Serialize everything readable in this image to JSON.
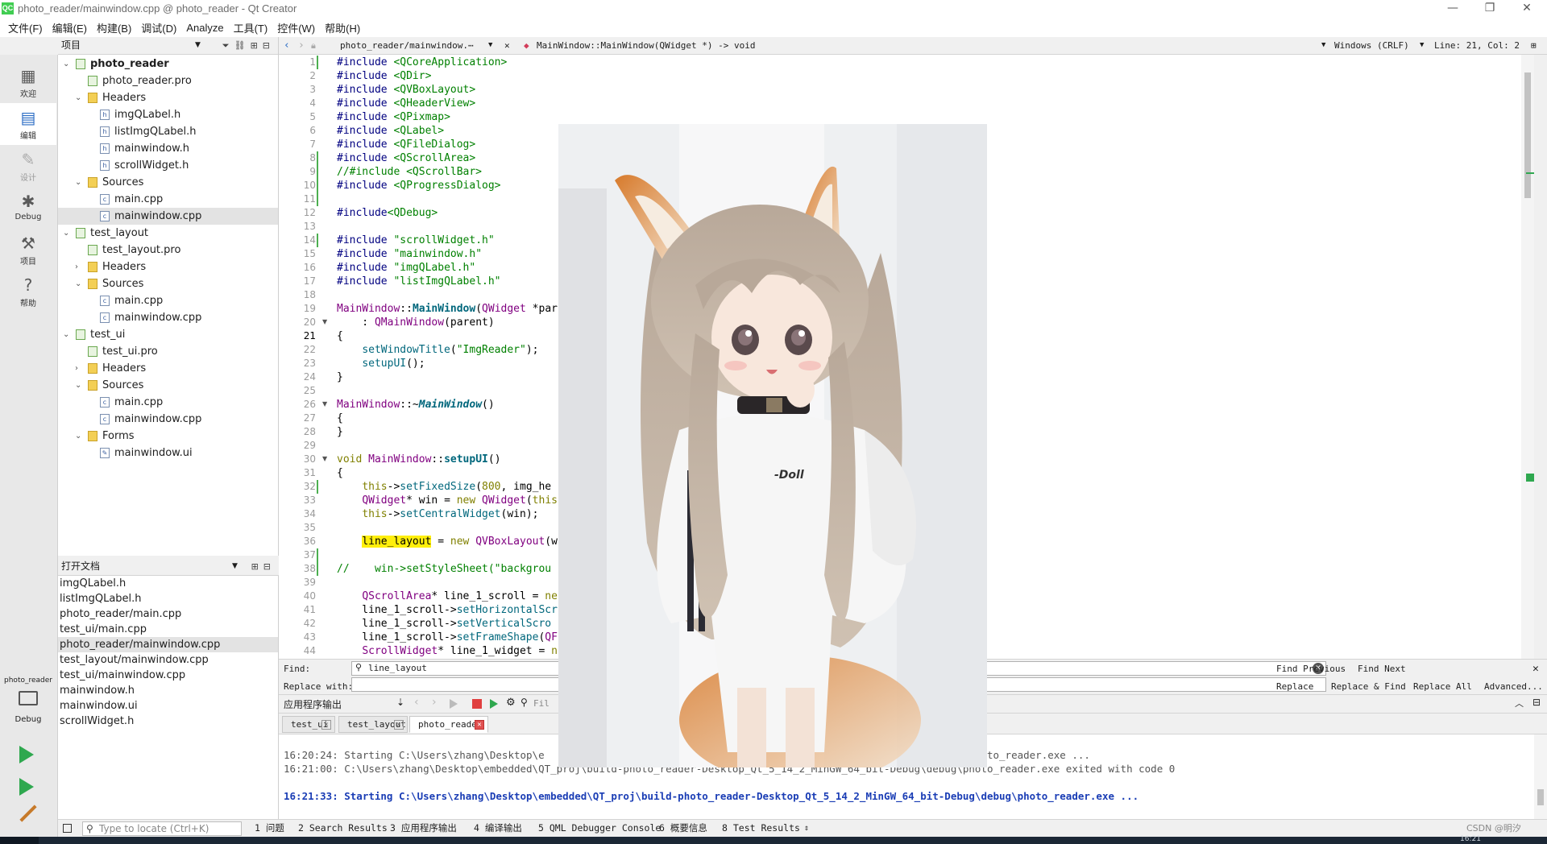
{
  "window": {
    "title": "photo_reader/mainwindow.cpp @ photo_reader - Qt Creator",
    "logo": "QC"
  },
  "menu": [
    "文件(F)",
    "编辑(E)",
    "构建(B)",
    "调试(D)",
    "Analyze",
    "工具(T)",
    "控件(W)",
    "帮助(H)"
  ],
  "modes": [
    {
      "label": "欢迎",
      "icon": "grid-icon"
    },
    {
      "label": "编辑",
      "icon": "edit-doc-icon"
    },
    {
      "label": "设计",
      "icon": "pencil-icon"
    },
    {
      "label": "Debug",
      "icon": "bug-icon"
    },
    {
      "label": "项目",
      "icon": "wrench-icon"
    },
    {
      "label": "帮助",
      "icon": "help-icon"
    }
  ],
  "kit": {
    "project": "photo_reader",
    "config": "Debug"
  },
  "project_panel": {
    "title": "项目",
    "tree": [
      {
        "text": "photo_reader",
        "depth": 0,
        "type": "pro-root",
        "expanded": true,
        "bold": true
      },
      {
        "text": "photo_reader.pro",
        "depth": 1,
        "type": "pro"
      },
      {
        "text": "Headers",
        "depth": 1,
        "type": "folder",
        "expanded": true
      },
      {
        "text": "imgQLabel.h",
        "depth": 2,
        "type": "file"
      },
      {
        "text": "listImgQLabel.h",
        "depth": 2,
        "type": "file"
      },
      {
        "text": "mainwindow.h",
        "depth": 2,
        "type": "file"
      },
      {
        "text": "scrollWidget.h",
        "depth": 2,
        "type": "file"
      },
      {
        "text": "Sources",
        "depth": 1,
        "type": "folder",
        "expanded": true
      },
      {
        "text": "main.cpp",
        "depth": 2,
        "type": "file"
      },
      {
        "text": "mainwindow.cpp",
        "depth": 2,
        "type": "file",
        "selected": true
      },
      {
        "text": "test_layout",
        "depth": 0,
        "type": "pro-root",
        "expanded": true
      },
      {
        "text": "test_layout.pro",
        "depth": 1,
        "type": "pro"
      },
      {
        "text": "Headers",
        "depth": 1,
        "type": "folder",
        "expanded": false
      },
      {
        "text": "Sources",
        "depth": 1,
        "type": "folder",
        "expanded": true
      },
      {
        "text": "main.cpp",
        "depth": 2,
        "type": "file"
      },
      {
        "text": "mainwindow.cpp",
        "depth": 2,
        "type": "file"
      },
      {
        "text": "test_ui",
        "depth": 0,
        "type": "pro-root",
        "expanded": true
      },
      {
        "text": "test_ui.pro",
        "depth": 1,
        "type": "pro"
      },
      {
        "text": "Headers",
        "depth": 1,
        "type": "folder",
        "expanded": false
      },
      {
        "text": "Sources",
        "depth": 1,
        "type": "folder",
        "expanded": true
      },
      {
        "text": "main.cpp",
        "depth": 2,
        "type": "file"
      },
      {
        "text": "mainwindow.cpp",
        "depth": 2,
        "type": "file"
      },
      {
        "text": "Forms",
        "depth": 1,
        "type": "folder",
        "expanded": true
      },
      {
        "text": "mainwindow.ui",
        "depth": 2,
        "type": "ui"
      }
    ]
  },
  "open_docs": {
    "title": "打开文档",
    "items": [
      {
        "text": "imgQLabel.h"
      },
      {
        "text": "listImgQLabel.h"
      },
      {
        "text": "photo_reader/main.cpp"
      },
      {
        "text": "test_ui/main.cpp"
      },
      {
        "text": "photo_reader/mainwindow.cpp",
        "selected": true
      },
      {
        "text": "test_layout/mainwindow.cpp"
      },
      {
        "text": "test_ui/mainwindow.cpp"
      },
      {
        "text": "mainwindow.h"
      },
      {
        "text": "mainwindow.ui"
      },
      {
        "text": "scrollWidget.h"
      }
    ]
  },
  "editor_toolbar": {
    "file": "photo_reader/mainwindow.⋯",
    "symbol": "MainWindow::MainWindow(QWidget *) -> void",
    "encoding": "Windows (CRLF)",
    "position": "Line: 21, Col: 2"
  },
  "editor": {
    "current_line": 21,
    "lines": [
      {
        "n": 1,
        "chg": true,
        "html": "<span class=\"pp\">#include</span> <span class=\"str\">&lt;QCoreApplication&gt;</span>"
      },
      {
        "n": 2,
        "html": "<span class=\"pp\">#include</span> <span class=\"str\">&lt;QDir&gt;</span>"
      },
      {
        "n": 3,
        "html": "<span class=\"pp\">#include</span> <span class=\"str\">&lt;QVBoxLayout&gt;</span>"
      },
      {
        "n": 4,
        "html": "<span class=\"pp\">#include</span> <span class=\"str\">&lt;QHeaderView&gt;</span>"
      },
      {
        "n": 5,
        "html": "<span class=\"pp\">#include</span> <span class=\"str\">&lt;QPixmap&gt;</span>"
      },
      {
        "n": 6,
        "html": "<span class=\"pp\">#include</span> <span class=\"str\">&lt;QLabel&gt;</span>"
      },
      {
        "n": 7,
        "html": "<span class=\"pp\">#include</span> <span class=\"str\">&lt;QFileDialog&gt;</span>"
      },
      {
        "n": 8,
        "chg": true,
        "html": "<span class=\"pp\">#include</span> <span class=\"str\">&lt;QScrollArea&gt;</span>"
      },
      {
        "n": 9,
        "chg": true,
        "html": "<span class=\"cm\">//#include &lt;QScrollBar&gt;</span>"
      },
      {
        "n": 10,
        "chg": true,
        "html": "<span class=\"pp\">#include</span> <span class=\"str\">&lt;QProgressDialog&gt;</span>"
      },
      {
        "n": 11,
        "chg": true,
        "html": ""
      },
      {
        "n": 12,
        "html": "<span class=\"pp\">#include</span><span class=\"str\">&lt;QDebug&gt;</span>"
      },
      {
        "n": 13,
        "html": ""
      },
      {
        "n": 14,
        "chg": true,
        "html": "<span class=\"pp\">#include</span> <span class=\"str\">\"scrollWidget.h\"</span>"
      },
      {
        "n": 15,
        "html": "<span class=\"pp\">#include</span> <span class=\"str\">\"mainwindow.h\"</span>"
      },
      {
        "n": 16,
        "html": "<span class=\"pp\">#include</span> <span class=\"str\">\"imgQLabel.h\"</span>"
      },
      {
        "n": 17,
        "html": "<span class=\"pp\">#include</span> <span class=\"str\">\"listImgQLabel.h\"</span>"
      },
      {
        "n": 18,
        "html": ""
      },
      {
        "n": 19,
        "html": "<span class=\"cls\">MainWindow</span>::<span class=\"fn\"><b>MainWindow</b></span>(<span class=\"cls\">QWidget</span> *par"
      },
      {
        "n": 20,
        "fold": true,
        "html": "    : <span class=\"cls\">QMainWindow</span>(parent)"
      },
      {
        "n": 21,
        "html": "{"
      },
      {
        "n": 22,
        "html": "    <span class=\"fn\">setWindowTitle</span>(<span class=\"str\">\"ImgReader\"</span>);"
      },
      {
        "n": 23,
        "html": "    <span class=\"fn\">setupUI</span>();"
      },
      {
        "n": 24,
        "html": "}"
      },
      {
        "n": 25,
        "html": ""
      },
      {
        "n": 26,
        "fold": true,
        "html": "<span class=\"cls\">MainWindow</span>::~<span class=\"fni\"><b>MainWindow</b></span>()"
      },
      {
        "n": 27,
        "html": "{"
      },
      {
        "n": 28,
        "html": "}"
      },
      {
        "n": 29,
        "html": ""
      },
      {
        "n": 30,
        "fold": true,
        "html": "<span class=\"kw\">void</span> <span class=\"cls\">MainWindow</span>::<span class=\"fn\"><b>setupUI</b></span>()"
      },
      {
        "n": 31,
        "html": "{"
      },
      {
        "n": 32,
        "chg": true,
        "html": "    <span class=\"kw\">this</span>-&gt;<span class=\"fn\">setFixedSize</span>(<span class=\"kw\">800</span>, img_he"
      },
      {
        "n": 33,
        "html": "    <span class=\"cls\">QWidget</span>* win = <span class=\"kw\">new</span> <span class=\"cls\">QWidget</span>(<span class=\"kw\">this</span>"
      },
      {
        "n": 34,
        "html": "    <span class=\"kw\">this</span>-&gt;<span class=\"fn\">setCentralWidget</span>(win);"
      },
      {
        "n": 35,
        "html": ""
      },
      {
        "n": 36,
        "html": "    <span class=\"hl\">line_layout</span> = <span class=\"kw\">new</span> <span class=\"cls\">QVBoxLayout</span>(w"
      },
      {
        "n": 37,
        "chg": true,
        "html": ""
      },
      {
        "n": 38,
        "chg": true,
        "html": "<span class=\"cm\">//    win-&gt;setStyleSheet(\"backgrou</span>"
      },
      {
        "n": 39,
        "html": ""
      },
      {
        "n": 40,
        "html": "    <span class=\"cls\">QScrollArea</span>* line_1_scroll = <span class=\"kw\">ne</span>"
      },
      {
        "n": 41,
        "html": "    line_1_scroll-&gt;<span class=\"fn\">setHorizontalScr</span>"
      },
      {
        "n": 42,
        "html": "    line_1_scroll-&gt;<span class=\"fn\">setVerticalScro</span>"
      },
      {
        "n": 43,
        "html": "    line_1_scroll-&gt;<span class=\"fn\">setFrameShape</span>(<span class=\"cls\">QF</span>"
      },
      {
        "n": 44,
        "html": "    <span class=\"cls\">ScrollWidget</span>* line_1_widget = <span class=\"kw\">n</span>"
      }
    ]
  },
  "find": {
    "find_label": "Find:",
    "replace_label": "Replace with:",
    "find_value": "line_layout",
    "find_previous": "Find Previous",
    "find_next": "Find Next",
    "replace": "Replace",
    "replace_find": "Replace & Find",
    "replace_all": "Replace All",
    "advanced": "Advanced..."
  },
  "output": {
    "title": "应用程序输出",
    "filter_placeholder": "Fil",
    "tabs": [
      "test_ui",
      "test_layout",
      "photo_reader"
    ],
    "active_tab": 2,
    "lines": [
      {
        "style": "g",
        "text": "16:20:24: Starting C:\\Users\\zhang\\Desktop\\e                                                          Debug\\debug\\photo_reader.exe ..."
      },
      {
        "style": "g",
        "text": "16:21:00: C:\\Users\\zhang\\Desktop\\embedded\\QT_proj\\build-photo_reader-Desktop_Qt_5_14_2_MinGW_64_bit-Debug\\debug\\photo_reader.exe exited with code 0"
      },
      {
        "style": "blank",
        "text": ""
      },
      {
        "style": "b",
        "text": "16:21:33: Starting C:\\Users\\zhang\\Desktop\\embedded\\QT_proj\\build-photo_reader-Desktop_Qt_5_14_2_MinGW_64_bit-Debug\\debug\\photo_reader.exe ..."
      }
    ]
  },
  "statusbar": {
    "locator_placeholder": "Type to locate (Ctrl+K)",
    "items": [
      "1 问题",
      "2 Search Results",
      "3 应用程序输出",
      "4 编译输出",
      "5 QML Debugger Console",
      "6 概要信息",
      "8 Test Results"
    ],
    "watermark": "CSDN @明汐",
    "clock": "16:21"
  },
  "photo": {
    "shirt_text": "-Doll"
  }
}
